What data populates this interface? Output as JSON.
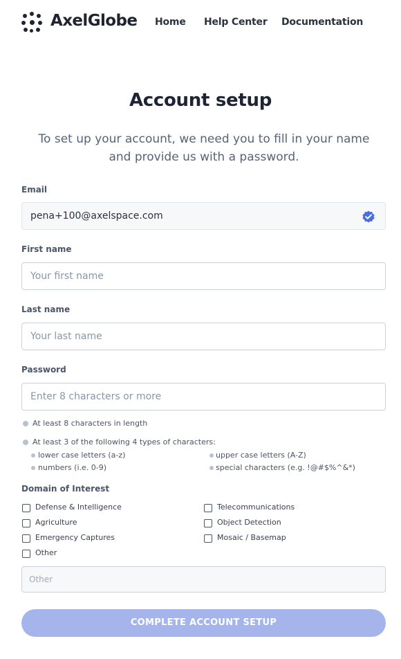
{
  "brand": {
    "name": "AxelGlobe"
  },
  "nav": {
    "links": [
      "Home",
      "Help Center",
      "Documentation"
    ]
  },
  "page": {
    "title": "Account setup",
    "subtitle": "To set up your account, we need you to fill in your name and provide us with a password."
  },
  "form": {
    "email": {
      "label": "Email",
      "value": "pena+100@axelspace.com",
      "verified": true,
      "icon": "verified-badge-icon"
    },
    "first_name": {
      "label": "First name",
      "placeholder": "Your first name"
    },
    "last_name": {
      "label": "Last name",
      "placeholder": "Your last name"
    },
    "password": {
      "label": "Password",
      "placeholder": "Enter 8 characters or more",
      "rules": {
        "length": "At least 8 characters in length",
        "types": "At least 3 of the following 4 types of characters:",
        "lower": "lower case letters (a-z)",
        "upper": "upper case letters (A-Z)",
        "numbers": "numbers (i.e. 0-9)",
        "special": "special characters (e.g. !@#$%^&*)"
      }
    },
    "domain": {
      "label": "Domain of Interest",
      "options": [
        "Defense & Intelligence",
        "Telecommunications",
        "Agriculture",
        "Object Detection",
        "Emergency Captures",
        "Mosaic / Basemap",
        "Other"
      ],
      "other_placeholder": "Other"
    },
    "submit_label": "COMPLETE ACCOUNT SETUP"
  },
  "colors": {
    "accent": "#a5b4ea",
    "verified": "#4a6ee0"
  }
}
